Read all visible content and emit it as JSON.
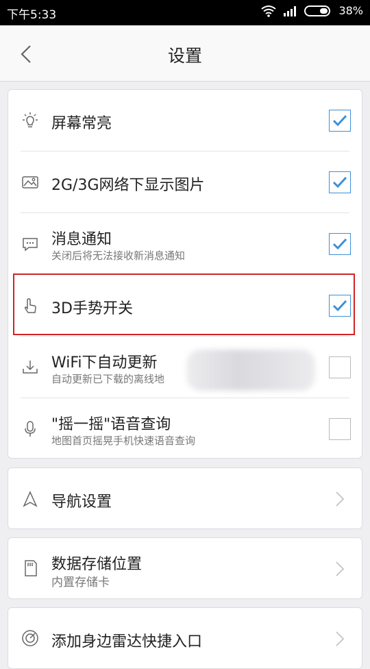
{
  "status_bar": {
    "time": "下午5:33",
    "battery": "38%"
  },
  "header": {
    "title": "设置",
    "back_icon": "chevron-left-icon"
  },
  "toggles": [
    {
      "label": "屏幕常亮",
      "subtitle": "",
      "checked": true,
      "icon": "lightbulb-icon"
    },
    {
      "label": "2G/3G网络下显示图片",
      "subtitle": "",
      "checked": true,
      "icon": "image-icon"
    },
    {
      "label": "消息通知",
      "subtitle": "关闭后将无法接收新消息通知",
      "checked": true,
      "icon": "chat-bubble-icon"
    },
    {
      "label": "3D手势开关",
      "subtitle": "",
      "checked": true,
      "icon": "touch-gesture-icon"
    },
    {
      "label": "WiFi下自动更新",
      "subtitle": "自动更新已下载的离线地",
      "checked": false,
      "icon": "download-tray-icon"
    },
    {
      "label": "\"摇一摇\"语音查询",
      "subtitle": "地图首页摇晃手机快速语音查询",
      "checked": false,
      "icon": "microphone-icon"
    }
  ],
  "links": [
    {
      "label": "导航设置",
      "subtitle": "",
      "icon": "navigation-arrow-icon"
    },
    {
      "label": "数据存储位置",
      "subtitle": "内置存储卡",
      "icon": "sd-card-icon"
    },
    {
      "label": "添加身边雷达快捷入口",
      "subtitle": "",
      "icon": "radar-icon"
    }
  ],
  "colors": {
    "accent": "#3d8fd8",
    "highlight": "#d02424",
    "background": "#efeff1"
  }
}
